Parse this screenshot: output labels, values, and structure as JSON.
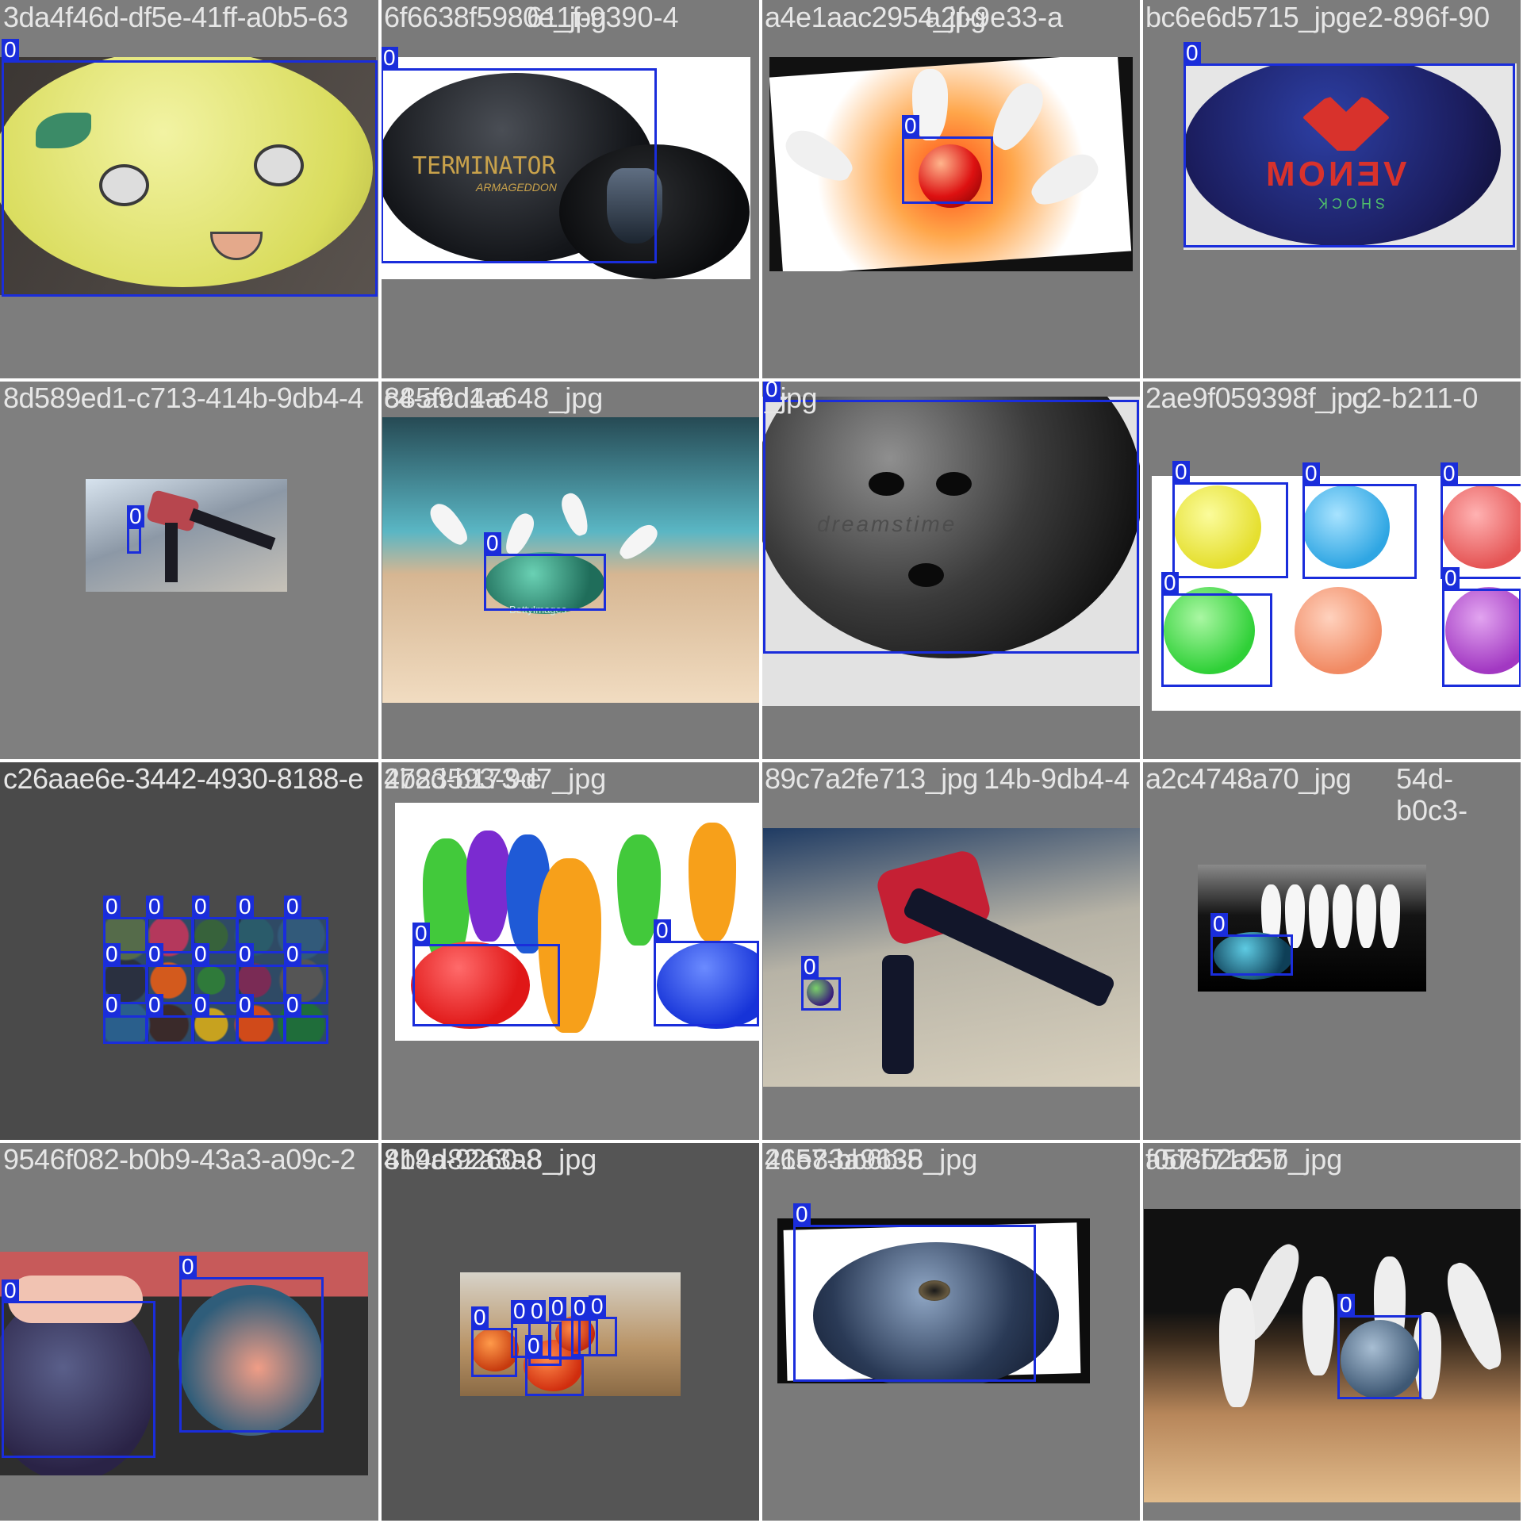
{
  "grid": {
    "tiles": [
      {
        "title": "3da4f46d-df5e-41ff-a0b5-63",
        "bg": "#7d7d7d",
        "label": "0"
      },
      {
        "title": "6f6638f5980e_jpg",
        "overlay_title": "611f-9390-4",
        "bg": "#7a7a7a",
        "label": "0"
      },
      {
        "title": "a4e1aac2954_jpg",
        "overlay_title": "a2f-9e33-a",
        "bg": "#7a7a7a",
        "label": "0"
      },
      {
        "title": "bc6e6d5715_jpg",
        "overlay_title": "e2-896f-90",
        "bg": "#7c7c7c",
        "label": "0"
      },
      {
        "title": "8d589ed1-c713-414b-9db4-4",
        "overlay_title": "885fcd4a648_jpg",
        "bg": "#7f7f7f",
        "label": "0"
      },
      {
        "title": "c4-a9d1-a",
        "bg": "#7a7a7a",
        "label": "0"
      },
      {
        "title": "_jpg",
        "bg": "#7b7b7b",
        "label": "0"
      },
      {
        "title": "2ae9f059398f_jpg",
        "overlay_title": "c2-b211-0",
        "bg": "#7c7c7c",
        "label": "0"
      },
      {
        "title": "c26aae6e-3442-4930-8188-e",
        "overlay_title": "2b23593-9d7_jpg",
        "bg": "#4a4a4a",
        "label": "0"
      },
      {
        "title": "478d-b173-e",
        "bg": "#7b7b7b",
        "label": "0"
      },
      {
        "title": "89c7a2fe713_jpg",
        "overlay_title": "14b-9db4-4",
        "bg": "#7c7c7c",
        "label": "0"
      },
      {
        "title": "a2c4748a70_jpg",
        "overlay_title": "54d-b0c3-",
        "bg": "#7a7a7a",
        "label": "0"
      },
      {
        "title": "9546f082-b0b9-43a3-a09c-2",
        "overlay_title": "8b4d82a3a8_jpg",
        "bg": "#7b7b7b",
        "label": "0"
      },
      {
        "title": "419a-9260-8",
        "overlay_title": "21e83a9638_jpg",
        "bg": "#555555",
        "label": "0"
      },
      {
        "title": "4657-bb6b-5",
        "overlay_title": "f0d8f71d5b_jpg",
        "bg": "#7a7a7a",
        "label": "0"
      },
      {
        "title": "a57-b2a2-7",
        "bg": "#7c7c7c",
        "label": "0"
      }
    ]
  },
  "image_text": {
    "terminator": "TERMINATOR",
    "armageddon": "ARMAGEDDON",
    "venom": "VENOM",
    "shock": "SHOCK",
    "dreamstime": "dreamstime",
    "betty": "BettyImages"
  },
  "colors": {
    "box": "#1a2ddb",
    "title_text": "#e6e6e6"
  }
}
